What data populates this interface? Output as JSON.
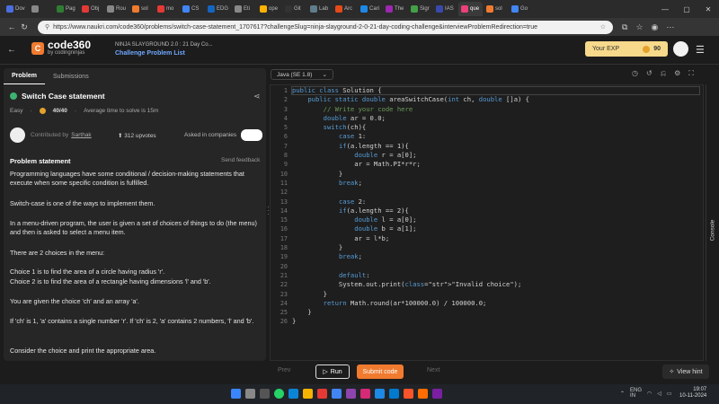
{
  "browser": {
    "tabs": [
      {
        "label": "Dov",
        "color": "#4a6ee0"
      },
      {
        "label": "",
        "color": "#888888"
      },
      {
        "label": "Pag",
        "color": "#2e7d32"
      },
      {
        "label": "Obj",
        "color": "#e53935"
      },
      {
        "label": "Rou",
        "color": "#888888"
      },
      {
        "label": "sol",
        "color": "#f07b2f"
      },
      {
        "label": "mo",
        "color": "#e53935"
      },
      {
        "label": "CS",
        "color": "#4285f4"
      },
      {
        "label": "EDG",
        "color": "#1565c0"
      },
      {
        "label": "Eti",
        "color": "#888888"
      },
      {
        "label": "ope",
        "color": "#ffb300"
      },
      {
        "label": "Git",
        "color": "#333333"
      },
      {
        "label": "Lab",
        "color": "#607d8b"
      },
      {
        "label": "Arc",
        "color": "#e64a19"
      },
      {
        "label": "Cari",
        "color": "#1e88e5"
      },
      {
        "label": "The",
        "color": "#9c27b0"
      },
      {
        "label": "Sigr",
        "color": "#43a047"
      },
      {
        "label": "IAS",
        "color": "#3949ab"
      },
      {
        "label": "que",
        "color": "#ec407a"
      },
      {
        "label": "sol",
        "color": "#f07b2f"
      },
      {
        "label": "Go",
        "color": "#4285f4"
      }
    ],
    "window_controls": [
      "—",
      "▢",
      "✕"
    ],
    "url": "https://www.naukri.com/code360/problems/switch-case-statement_1707617?challengeSlug=ninja-slayground-2-0-21-day-coding-challenge&interviewProblemRedirection=true"
  },
  "header": {
    "logo_mark": "C",
    "logo_name": "code360",
    "logo_sub": "by codingninjas",
    "challenge_title": "NINJA SLAYGROUND 2.0 : 21 Day Co...",
    "challenge_link": "Challenge Problem List",
    "exp_label": "Your EXP",
    "exp_value": "90"
  },
  "left": {
    "tabs": [
      "Problem",
      "Submissions"
    ],
    "title": "Switch Case statement",
    "difficulty": "Easy",
    "score": "40/40",
    "avg_time": "Average time to solve is 15m",
    "contributed_label": "Contributed by",
    "contributor": "Sarthak",
    "upvotes": "312 upvotes",
    "companies_label": "Asked in companies",
    "statement_header": "Problem statement",
    "send_feedback": "Send feedback",
    "p1": "Programming languages have some conditional / decision-making statements that execute when some specific condition is fulfilled.",
    "p2": "Switch-case is one of the ways to implement them.",
    "p3": "In a menu-driven program, the user is given a set of choices of things to do (the menu) and then is asked to select a menu item.",
    "p4": "There are 2 choices in the menu:",
    "p5a": "Choice 1 is to find the area of a circle having radius 'r'.",
    "p5b": "Choice 2 is to find the area of a rectangle having dimensions 'l' and 'b'.",
    "p6": "You are given the choice 'ch' and an array 'a'.",
    "p7": "If 'ch' is 1, 'a' contains a single number 'r'. If 'ch' is 2, 'a' contains 2 numbers, 'l' and 'b'.",
    "p8": "Consider the choice and print the appropriate area."
  },
  "editor": {
    "language": "Java (SE 1.8)",
    "console_label": "Console",
    "lines": [
      "public class Solution {",
      "    public static double areaSwitchCase(int ch, double []a) {",
      "        // Write your code here",
      "        double ar = 0.0;",
      "        switch(ch){",
      "            case 1:",
      "            if(a.length == 1){",
      "                double r = a[0];",
      "                ar = Math.PI*r*r;",
      "            }",
      "            break;",
      "",
      "            case 2:",
      "            if(a.length == 2){",
      "                double l = a[0];",
      "                double b = a[1];",
      "                ar = l*b;",
      "            }",
      "            break;",
      "",
      "            default:",
      "            System.out.print(\"Invalid choice\");",
      "        }",
      "        return Math.round(ar*100000.0) / 100000.0;",
      "    }",
      "}"
    ]
  },
  "footer": {
    "prev": "Prev",
    "run": "Run",
    "submit": "Submit code",
    "next": "Next",
    "hint": "View hint"
  },
  "taskbar": {
    "lang": "ENG",
    "region": "IN",
    "time": "19:07",
    "date": "10-11-2024"
  }
}
